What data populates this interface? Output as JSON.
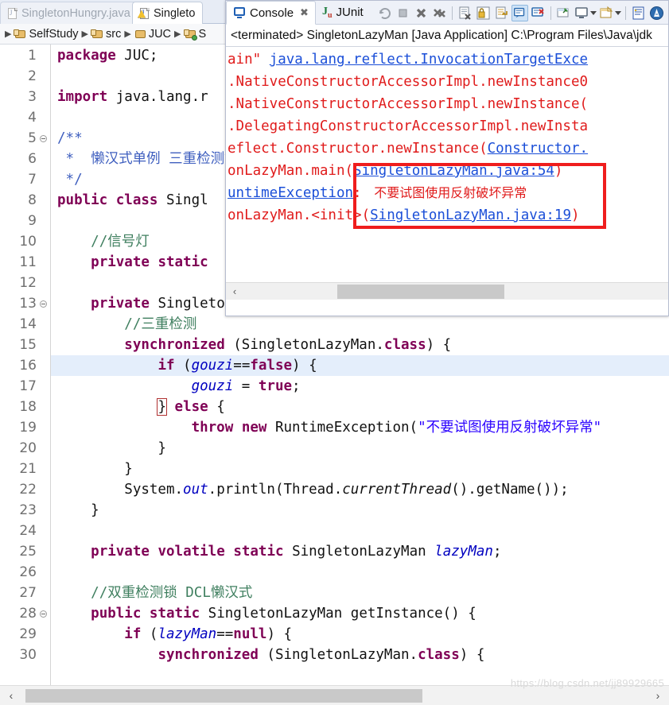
{
  "editor": {
    "tabs": [
      {
        "label": "SingletonHungry.java",
        "icon": "java-file-icon",
        "active": false
      },
      {
        "label": "Singleto",
        "icon": "java-file-warning-icon",
        "active": true
      }
    ],
    "breadcrumb": [
      {
        "label": "SelfStudy",
        "icon": "java-project-icon"
      },
      {
        "label": "src",
        "icon": "source-folder-icon"
      },
      {
        "label": "JUC",
        "icon": "package-icon"
      },
      {
        "label": "S",
        "icon": "java-class-run-icon"
      }
    ],
    "highlighted_line": 16,
    "lines": [
      {
        "n": 1,
        "fold": false,
        "html": "<span class=\"kw\">package</span> JUC;"
      },
      {
        "n": 2,
        "fold": false,
        "html": ""
      },
      {
        "n": 3,
        "fold": false,
        "html": "<span class=\"kw\">import</span> java.lang.r"
      },
      {
        "n": 4,
        "fold": false,
        "html": ""
      },
      {
        "n": 5,
        "fold": true,
        "html": "<span class=\"jd\">/**</span>"
      },
      {
        "n": 6,
        "fold": false,
        "html": "<span class=\"jd\"> *  懒汉式单例 三重检测锁</span>"
      },
      {
        "n": 7,
        "fold": false,
        "html": "<span class=\"jd\"> */</span>"
      },
      {
        "n": 8,
        "fold": false,
        "html": "<span class=\"kw\">public</span> <span class=\"kw\">class</span> Singl"
      },
      {
        "n": 9,
        "fold": false,
        "html": ""
      },
      {
        "n": 10,
        "fold": false,
        "html": "    <span class=\"cm\">//信号灯</span>"
      },
      {
        "n": 11,
        "fold": false,
        "html": "    <span class=\"kw\">private</span> <span class=\"kw\">static</span>"
      },
      {
        "n": 12,
        "fold": false,
        "html": ""
      },
      {
        "n": 13,
        "fold": true,
        "html": "    <span class=\"kw\">private</span> SingletonLazyMan(){"
      },
      {
        "n": 14,
        "fold": false,
        "html": "        <span class=\"cm\">//三重检测</span>"
      },
      {
        "n": 15,
        "fold": false,
        "html": "        <span class=\"kw\">synchronized</span> (SingletonLazyMan.<span class=\"kw\">class</span>) {"
      },
      {
        "n": 16,
        "fold": false,
        "html": "            <span class=\"kw\">if</span> (<span class=\"fld\">gouzi</span>==<span class=\"kw\">false</span>) {"
      },
      {
        "n": 17,
        "fold": false,
        "html": "                <span class=\"fld\">gouzi</span> = <span class=\"kw\">true</span>;"
      },
      {
        "n": 18,
        "fold": false,
        "html": "            <span class=\"brkt-box\">}</span> <span class=\"kw\">else</span> {"
      },
      {
        "n": 19,
        "fold": false,
        "html": "                <span class=\"kw\">throw</span> <span class=\"kw\">new</span> RuntimeException(<span class=\"st\">\"不要试图使用反射破坏异常\"</span>"
      },
      {
        "n": 20,
        "fold": false,
        "html": "            }"
      },
      {
        "n": 21,
        "fold": false,
        "html": "        }"
      },
      {
        "n": 22,
        "fold": false,
        "html": "        System.<span class=\"fld\">out</span>.println(Thread.<span class=\"mth\">currentThread</span>().getName());"
      },
      {
        "n": 23,
        "fold": false,
        "html": "    }"
      },
      {
        "n": 24,
        "fold": false,
        "html": ""
      },
      {
        "n": 25,
        "fold": false,
        "html": "    <span class=\"kw\">private</span> <span class=\"kw\">volatile</span> <span class=\"kw\">static</span> SingletonLazyMan <span class=\"fld\">lazyMan</span>;"
      },
      {
        "n": 26,
        "fold": false,
        "html": ""
      },
      {
        "n": 27,
        "fold": false,
        "html": "    <span class=\"cm\">//双重检测锁 DCL懒汉式</span>"
      },
      {
        "n": 28,
        "fold": true,
        "html": "    <span class=\"kw\">public</span> <span class=\"kw\">static</span> SingletonLazyMan getInstance() {"
      },
      {
        "n": 29,
        "fold": false,
        "html": "        <span class=\"kw\">if</span> (<span class=\"fld\">lazyMan</span>==<span class=\"kw\">null</span>) {"
      },
      {
        "n": 30,
        "fold": false,
        "html": "            <span class=\"kw\">synchronized</span> (SingletonLazyMan.<span class=\"kw\">class</span>) {"
      }
    ]
  },
  "console": {
    "tabs": [
      {
        "label": "Console",
        "icon": "console-icon",
        "active": true,
        "closeable": true
      },
      {
        "label": "JUnit",
        "icon": "junit-icon",
        "active": false,
        "closeable": false
      }
    ],
    "close_glyph": "✖",
    "toolbar": [
      {
        "name": "relaunch-button",
        "selected": false
      },
      {
        "name": "terminate-button",
        "selected": false
      },
      {
        "name": "remove-launch-button",
        "selected": false
      },
      {
        "name": "remove-all-terminated-button",
        "selected": false
      },
      {
        "name": "clear-console-button",
        "selected": false
      },
      {
        "name": "scroll-lock-button",
        "selected": false
      },
      {
        "name": "word-wrap-button",
        "selected": false
      },
      {
        "name": "show-console-on-output-button",
        "selected": true
      },
      {
        "name": "show-console-on-error-button",
        "selected": false
      },
      {
        "name": "pin-console-button",
        "selected": false
      },
      {
        "name": "display-selected-console-button",
        "selected": false
      },
      {
        "name": "open-console-button",
        "selected": false
      },
      {
        "name": "view-menu-button",
        "selected": false
      },
      {
        "name": "alert-button",
        "selected": false
      }
    ],
    "title": "<terminated> SingletonLazyMan [Java Application] C:\\Program Files\\Java\\jdk",
    "stack_lines": [
      {
        "kind": "mixed",
        "segments": [
          {
            "t": "ain\" ",
            "c": "err"
          },
          {
            "t": "java.lang.reflect.InvocationTargetExce",
            "c": "lnk"
          }
        ]
      },
      {
        "kind": "mixed",
        "segments": [
          {
            "t": ".NativeConstructorAccessorImpl.newInstance0",
            "c": "err"
          }
        ]
      },
      {
        "kind": "mixed",
        "segments": [
          {
            "t": ".NativeConstructorAccessorImpl.newInstance(",
            "c": "err"
          }
        ]
      },
      {
        "kind": "mixed",
        "segments": [
          {
            "t": ".DelegatingConstructorAccessorImpl.newInsta",
            "c": "err"
          }
        ]
      },
      {
        "kind": "mixed",
        "segments": [
          {
            "t": "eflect.Constructor.newInstance(",
            "c": "err"
          },
          {
            "t": "Constructor.",
            "c": "lnk"
          }
        ]
      },
      {
        "kind": "mixed",
        "segments": [
          {
            "t": "onLazyMan.main(",
            "c": "err"
          },
          {
            "t": "SingletonLazyMan.java",
            "c": "lnk"
          },
          {
            "t": ":54",
            "c": "lnk"
          },
          {
            "t": ")",
            "c": "err"
          }
        ]
      },
      {
        "kind": "mixed",
        "segments": [
          {
            "t": "untimeException",
            "c": "lnk"
          },
          {
            "t": ": ",
            "c": "err"
          },
          {
            "t": " 不要试图使用反射破坏异常",
            "c": "cjk-err"
          }
        ]
      },
      {
        "kind": "mixed",
        "segments": [
          {
            "t": "onLazyMan.<init>(",
            "c": "err"
          },
          {
            "t": "SingletonLazyMan.java:19",
            "c": "lnk"
          },
          {
            "t": ")",
            "c": "err"
          }
        ]
      }
    ],
    "annotation_box_color": "#ef1d1d",
    "hscroll": {
      "left_glyph": "‹",
      "right_glyph": "›"
    }
  },
  "editor_scrollbar": {
    "left_glyph": "‹",
    "right_glyph": "›"
  },
  "watermark": "https://blog.csdn.net/jj89929665"
}
